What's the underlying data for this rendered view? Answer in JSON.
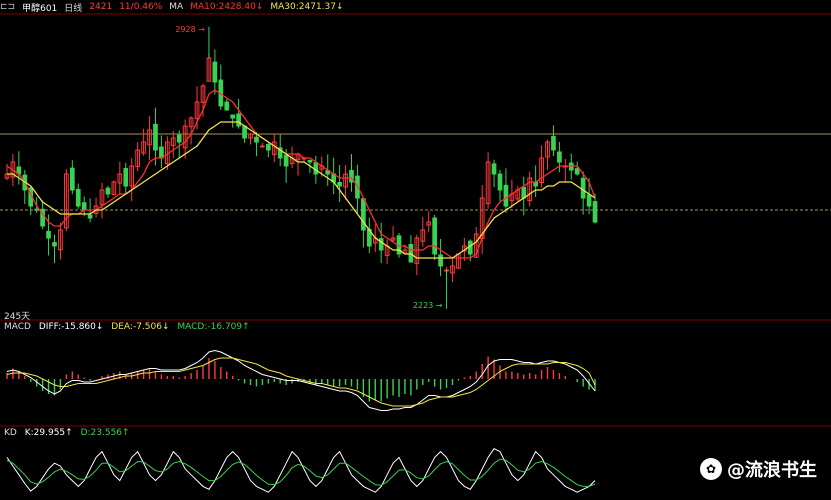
{
  "header": {
    "symbol": "甲醇601",
    "symbol_icon": "window-toggle-icon",
    "period": "日线",
    "price": "2421",
    "change": "11/0.46%",
    "ma_label": "MA",
    "ma10": "MA10:2428.40↓",
    "ma30": "MA30:2471.37↓"
  },
  "colors": {
    "up": "#ff3b3b",
    "down": "#39d353",
    "ma10": "#ff3030",
    "ma30": "#f1e64a",
    "diff": "#ffffff",
    "dea": "#f1e64a",
    "k": "#ffffff",
    "d": "#39d353",
    "hline": "#d6c96b",
    "panel_border": "#7a0000"
  },
  "main_panel": {
    "high_label": "2928",
    "low_label": "2223",
    "days_label": "245天"
  },
  "macd_panel": {
    "name": "MACD",
    "diff": "DIFF:-15.860↓",
    "dea": "DEA:-7.506↓",
    "macd": "MACD:-16.709↑"
  },
  "kd_panel": {
    "name": "KD",
    "k": "K:29.955↑",
    "d": "D:23.556↑"
  },
  "watermark": {
    "icon": "paw-icon",
    "text": "@流浪书生"
  },
  "chart_data": [
    {
      "type": "candlestick",
      "title": "",
      "x_count": 100,
      "ylim": [
        2200,
        2950
      ],
      "high_value": 2928,
      "low_value": 2223,
      "horizontal_lines": [
        2660,
        2470
      ],
      "close": [
        2560,
        2590,
        2560,
        2520,
        2480,
        2470,
        2430,
        2400,
        2380,
        2420,
        2560,
        2520,
        2480,
        2470,
        2450,
        2480,
        2520,
        2510,
        2540,
        2560,
        2530,
        2580,
        2620,
        2640,
        2670,
        2620,
        2600,
        2640,
        2650,
        2640,
        2680,
        2700,
        2740,
        2780,
        2850,
        2790,
        2730,
        2720,
        2700,
        2680,
        2650,
        2660,
        2640,
        2630,
        2620,
        2640,
        2600,
        2580,
        2600,
        2610,
        2600,
        2590,
        2560,
        2580,
        2560,
        2540,
        2530,
        2560,
        2540,
        2500,
        2420,
        2380,
        2400,
        2370,
        2380,
        2400,
        2360,
        2370,
        2340,
        2400,
        2420,
        2440,
        2360,
        2330,
        2320,
        2330,
        2360,
        2380,
        2360,
        2410,
        2500,
        2590,
        2560,
        2520,
        2480,
        2510,
        2520,
        2500,
        2550,
        2530,
        2600,
        2640,
        2620,
        2590,
        2580,
        2570,
        2560,
        2500,
        2480,
        2440
      ],
      "ma10": [
        2580,
        2570,
        2560,
        2540,
        2510,
        2480,
        2460,
        2440,
        2430,
        2430,
        2450,
        2460,
        2460,
        2470,
        2470,
        2470,
        2480,
        2490,
        2500,
        2510,
        2510,
        2520,
        2540,
        2560,
        2590,
        2600,
        2600,
        2610,
        2620,
        2630,
        2640,
        2660,
        2690,
        2720,
        2760,
        2770,
        2760,
        2750,
        2740,
        2720,
        2700,
        2680,
        2660,
        2650,
        2640,
        2630,
        2620,
        2610,
        2610,
        2610,
        2600,
        2600,
        2590,
        2580,
        2570,
        2560,
        2550,
        2550,
        2550,
        2530,
        2500,
        2470,
        2440,
        2410,
        2400,
        2390,
        2380,
        2380,
        2370,
        2370,
        2370,
        2380,
        2380,
        2370,
        2360,
        2350,
        2350,
        2350,
        2350,
        2360,
        2400,
        2440,
        2470,
        2490,
        2500,
        2510,
        2520,
        2530,
        2540,
        2540,
        2550,
        2560,
        2570,
        2580,
        2580,
        2580,
        2580,
        2560,
        2540,
        2500
      ],
      "ma30": [
        2560,
        2560,
        2550,
        2540,
        2530,
        2510,
        2490,
        2480,
        2470,
        2460,
        2460,
        2460,
        2460,
        2460,
        2460,
        2470,
        2470,
        2480,
        2490,
        2500,
        2510,
        2520,
        2530,
        2540,
        2550,
        2560,
        2570,
        2580,
        2590,
        2600,
        2610,
        2620,
        2630,
        2650,
        2670,
        2680,
        2690,
        2690,
        2690,
        2690,
        2680,
        2670,
        2660,
        2650,
        2640,
        2630,
        2620,
        2610,
        2600,
        2590,
        2590,
        2580,
        2570,
        2560,
        2550,
        2540,
        2520,
        2500,
        2480,
        2460,
        2440,
        2420,
        2400,
        2390,
        2380,
        2370,
        2370,
        2360,
        2360,
        2350,
        2350,
        2350,
        2350,
        2350,
        2350,
        2350,
        2360,
        2370,
        2380,
        2390,
        2410,
        2430,
        2450,
        2460,
        2470,
        2480,
        2490,
        2500,
        2510,
        2520,
        2520,
        2530,
        2530,
        2540,
        2540,
        2540,
        2530,
        2520,
        2510,
        2500
      ]
    },
    {
      "type": "bar",
      "title": "MACD",
      "ylim": [
        -60,
        60
      ],
      "histogram": [
        8,
        14,
        10,
        4,
        -4,
        -10,
        -16,
        -20,
        -22,
        -14,
        6,
        10,
        6,
        2,
        -2,
        0,
        4,
        6,
        8,
        10,
        6,
        8,
        10,
        12,
        14,
        10,
        6,
        4,
        4,
        2,
        4,
        8,
        12,
        18,
        28,
        24,
        16,
        10,
        4,
        -2,
        -6,
        -8,
        -10,
        -8,
        -6,
        -4,
        -6,
        -8,
        -6,
        -4,
        -4,
        -6,
        -8,
        -6,
        -8,
        -10,
        -10,
        -8,
        -10,
        -14,
        -24,
        -30,
        -28,
        -30,
        -26,
        -22,
        -24,
        -20,
        -22,
        -14,
        -8,
        -4,
        -10,
        -14,
        -12,
        -8,
        -2,
        2,
        4,
        10,
        20,
        30,
        26,
        18,
        10,
        10,
        8,
        6,
        8,
        6,
        12,
        16,
        12,
        8,
        4,
        0,
        -4,
        -10,
        -14,
        -16
      ],
      "diff": [
        10,
        12,
        10,
        6,
        2,
        -4,
        -10,
        -16,
        -20,
        -16,
        -6,
        -2,
        -2,
        -4,
        -4,
        -2,
        0,
        2,
        4,
        6,
        6,
        8,
        10,
        12,
        14,
        14,
        12,
        12,
        12,
        12,
        14,
        18,
        22,
        28,
        36,
        38,
        36,
        32,
        28,
        24,
        18,
        14,
        10,
        6,
        4,
        2,
        0,
        -2,
        -2,
        -2,
        -4,
        -6,
        -8,
        -10,
        -12,
        -14,
        -16,
        -16,
        -18,
        -22,
        -30,
        -38,
        -40,
        -42,
        -42,
        -40,
        -40,
        -38,
        -38,
        -34,
        -28,
        -22,
        -22,
        -24,
        -24,
        -22,
        -18,
        -14,
        -10,
        -4,
        6,
        18,
        24,
        26,
        26,
        26,
        24,
        22,
        22,
        20,
        22,
        24,
        24,
        22,
        20,
        16,
        12,
        4,
        -6,
        -16
      ],
      "dea": [
        6,
        8,
        8,
        8,
        6,
        4,
        0,
        -4,
        -8,
        -10,
        -10,
        -8,
        -6,
        -6,
        -6,
        -6,
        -4,
        -2,
        0,
        2,
        4,
        4,
        6,
        8,
        8,
        10,
        10,
        10,
        10,
        10,
        12,
        14,
        16,
        18,
        22,
        26,
        28,
        28,
        28,
        26,
        24,
        22,
        20,
        16,
        12,
        10,
        8,
        4,
        2,
        0,
        -2,
        -4,
        -6,
        -6,
        -8,
        -10,
        -12,
        -12,
        -14,
        -16,
        -20,
        -24,
        -28,
        -32,
        -34,
        -36,
        -36,
        -36,
        -36,
        -34,
        -32,
        -28,
        -26,
        -24,
        -24,
        -24,
        -22,
        -20,
        -18,
        -14,
        -8,
        -2,
        4,
        10,
        14,
        18,
        20,
        20,
        20,
        20,
        20,
        20,
        22,
        22,
        22,
        20,
        18,
        14,
        8,
        -8
      ]
    },
    {
      "type": "line",
      "title": "KD",
      "ylim": [
        0,
        100
      ],
      "k": [
        70,
        55,
        40,
        25,
        12,
        20,
        35,
        50,
        60,
        55,
        40,
        30,
        20,
        30,
        50,
        70,
        80,
        60,
        40,
        30,
        50,
        70,
        80,
        60,
        40,
        30,
        40,
        60,
        80,
        70,
        50,
        40,
        30,
        20,
        15,
        30,
        50,
        70,
        80,
        70,
        50,
        30,
        20,
        15,
        10,
        20,
        40,
        60,
        80,
        70,
        50,
        30,
        20,
        30,
        50,
        70,
        80,
        60,
        40,
        30,
        20,
        15,
        10,
        20,
        40,
        60,
        70,
        50,
        30,
        20,
        30,
        50,
        70,
        80,
        70,
        50,
        30,
        20,
        15,
        30,
        50,
        70,
        85,
        80,
        60,
        40,
        30,
        40,
        60,
        80,
        70,
        50,
        40,
        30,
        20,
        15,
        10,
        15,
        20,
        30
      ],
      "d": [
        65,
        60,
        50,
        40,
        28,
        24,
        28,
        36,
        45,
        50,
        46,
        40,
        33,
        32,
        38,
        48,
        60,
        60,
        53,
        45,
        47,
        55,
        63,
        62,
        55,
        47,
        45,
        50,
        60,
        63,
        59,
        53,
        45,
        37,
        30,
        30,
        37,
        48,
        58,
        62,
        58,
        49,
        39,
        31,
        24,
        23,
        28,
        39,
        52,
        58,
        55,
        47,
        38,
        35,
        40,
        50,
        60,
        60,
        53,
        45,
        37,
        30,
        23,
        22,
        28,
        38,
        48,
        49,
        43,
        35,
        33,
        38,
        49,
        59,
        63,
        59,
        49,
        39,
        31,
        31,
        37,
        48,
        60,
        67,
        65,
        57,
        48,
        45,
        50,
        60,
        63,
        59,
        53,
        45,
        37,
        30,
        23,
        20,
        20,
        24
      ]
    }
  ]
}
